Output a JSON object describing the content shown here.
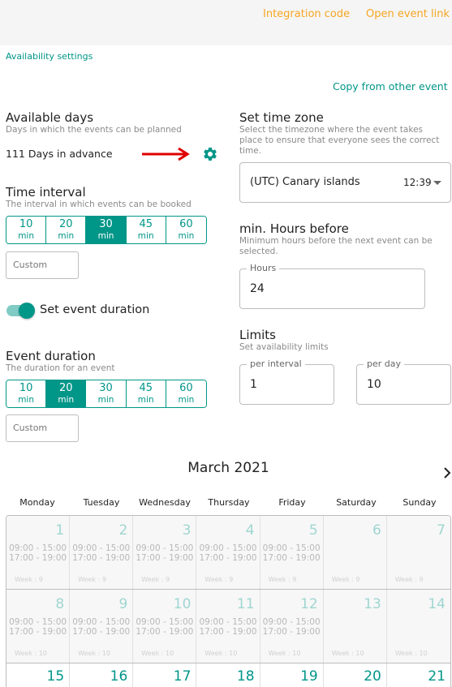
{
  "header": {
    "integration_code": "Integration code",
    "open_event_link": "Open event link"
  },
  "section_title": "Availability settings",
  "copy_from_other": "Copy from other event",
  "available_days": {
    "title": "Available days",
    "subtitle": "Days in which the events can be planned",
    "value": "111 Days in advance"
  },
  "time_interval": {
    "title": "Time interval",
    "subtitle": "The interval in which events can be booked",
    "options": [
      {
        "n": "10",
        "u": "min"
      },
      {
        "n": "20",
        "u": "min"
      },
      {
        "n": "30",
        "u": "min"
      },
      {
        "n": "45",
        "u": "min"
      },
      {
        "n": "60",
        "u": "min"
      }
    ],
    "selected": "30",
    "custom_placeholder": "Custom"
  },
  "set_event_duration": {
    "label": "Set event duration",
    "on": true
  },
  "event_duration": {
    "title": "Event duration",
    "subtitle": "The duration for an event",
    "options": [
      {
        "n": "10",
        "u": "min"
      },
      {
        "n": "20",
        "u": "min"
      },
      {
        "n": "30",
        "u": "min"
      },
      {
        "n": "45",
        "u": "min"
      },
      {
        "n": "60",
        "u": "min"
      }
    ],
    "selected": "20",
    "custom_placeholder": "Custom"
  },
  "timezone": {
    "title": "Set time zone",
    "subtitle": "Select the timezone where the event takes place to ensure that everyone sees the correct time.",
    "value": "(UTC) Canary islands",
    "time": "12:39"
  },
  "min_hours": {
    "title": "min. Hours before",
    "subtitle": "Minimum hours before the next event can be selected.",
    "label": "Hours",
    "value": "24"
  },
  "limits": {
    "title": "Limits",
    "subtitle": "Set availability limits",
    "per_interval_label": "per interval",
    "per_interval_value": "1",
    "per_day_label": "per day",
    "per_day_value": "10"
  },
  "calendar": {
    "month": "March 2021",
    "weekdays": [
      "Monday",
      "Tuesday",
      "Wednesday",
      "Thursday",
      "Friday",
      "Saturday",
      "Sunday"
    ],
    "weeks": [
      {
        "week": "Week : 9",
        "days": [
          "1",
          "2",
          "3",
          "4",
          "5",
          "6",
          "7"
        ],
        "slots": [
          [
            "09:00 - 15:00",
            "17:00 - 19:00"
          ],
          [
            "09:00 - 15:00",
            "17:00 - 19:00"
          ],
          [
            "09:00 - 15:00",
            "17:00 - 19:00"
          ],
          [
            "09:00 - 15:00",
            "17:00 - 19:00"
          ],
          [
            "09:00 - 15:00",
            "17:00 - 19:00"
          ],
          [],
          []
        ]
      },
      {
        "week": "Week : 10",
        "days": [
          "8",
          "9",
          "10",
          "11",
          "12",
          "13",
          "14"
        ],
        "slots": [
          [
            "09:00 - 15:00",
            "17:00 - 19:00"
          ],
          [
            "09:00 - 15:00",
            "17:00 - 19:00"
          ],
          [
            "09:00 - 15:00",
            "17:00 - 19:00"
          ],
          [
            "09:00 - 15:00",
            "17:00 - 19:00"
          ],
          [
            "09:00 - 15:00",
            "17:00 - 19:00"
          ],
          [],
          []
        ]
      },
      {
        "days": [
          "15",
          "16",
          "17",
          "18",
          "19",
          "20",
          "21"
        ]
      }
    ]
  },
  "colors": {
    "accent": "#009688",
    "link": "#f5a623",
    "arrow": "#e00000"
  }
}
